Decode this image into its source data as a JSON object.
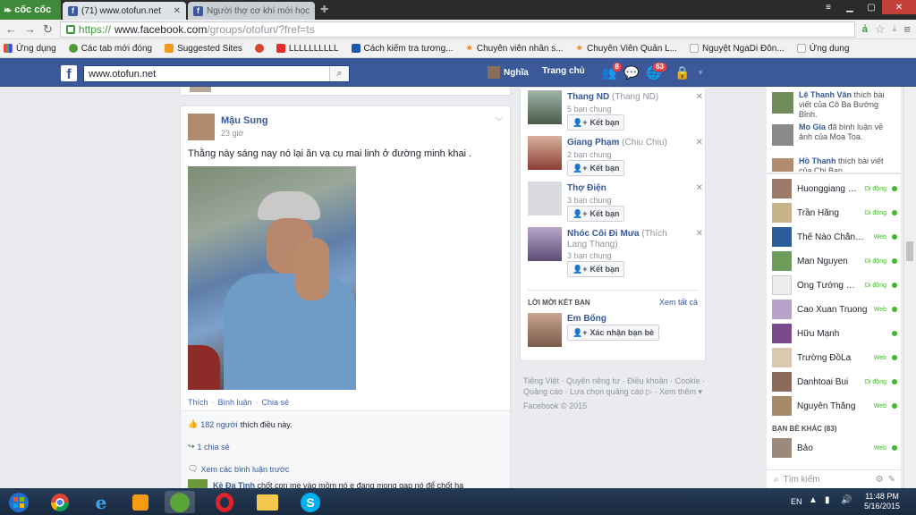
{
  "browser": {
    "brand": "cốc cốc",
    "tabs": [
      {
        "title": "(71) www.otofun.net",
        "active": true
      },
      {
        "title": "Người thợ cơ khí mới học",
        "active": false
      }
    ],
    "url_scheme": "https://",
    "url_host": "www.facebook.com",
    "url_path": "/groups/otofun/?fref=ts",
    "bookmarks": [
      "Ứng dụng",
      "Các tab mới đóng",
      "Suggested Sites",
      "LLLLLLLLLL",
      "Cách kiếm tra tương...",
      "Chuyên viên nhân s...",
      "Chuyên Viên Quản L...",
      "Nguyệt NgaDi Đôn...",
      "Ứng dung"
    ]
  },
  "fb": {
    "search_value": "www.otofun.net",
    "user_name": "Nghĩa",
    "home_label": "Trang chủ",
    "friend_badge": "8",
    "notif_badge": "63"
  },
  "post": {
    "author": "Mậu Sung",
    "time": "23 giờ",
    "text": "Thằng này sáng nay nó lại ăn vạ cụ mai linh ở đường minh khai .",
    "actions": [
      "Thích",
      "Bình luận",
      "Chia sẻ"
    ],
    "likes_count": "182 người",
    "likes_suffix": "thích điều này.",
    "shares": "1 chia sẻ",
    "view_comments": "Xem các bình luận trước",
    "comment_author": "Kẻ Đa Tình",
    "comment_text": "chốt con mẹ vào mồm nó e đang mong gap nó để chốt hạ"
  },
  "suggestions": [
    {
      "name": "Thang ND",
      "alias": "(Thang ND)",
      "mutual": "5 bạn chung",
      "button": "Kết bạn"
    },
    {
      "name": "Giang Phạm",
      "alias": "(Chiu Chiu)",
      "mutual": "2 bạn chung",
      "button": "Kết bạn"
    },
    {
      "name": "Thợ Điện",
      "alias": "",
      "mutual": "3 bạn chung",
      "button": "Kết bạn"
    },
    {
      "name": "Nhóc Côi Đi Mưa",
      "alias": "(Thích Lang Thang)",
      "mutual": "3 bạn chung",
      "button": "Kết bạn"
    }
  ],
  "friend_requests": {
    "title": "LỜI MỜI KẾT BẠN",
    "see_all": "Xem tất cả",
    "name": "Em Bống",
    "button": "Xác nhận bạn bè"
  },
  "footer": {
    "links": "Tiếng Việt · Quyền riêng tư · Điều khoản · Cookie · Quảng cáo · Lựa chọn quảng cáo ▷ · Xem thêm ▾",
    "copyright": "Facebook © 2015"
  },
  "ticker": [
    {
      "name": "Lê Thanh Vân",
      "text": "thích bài viết của Cô Ba Bướng Bỉnh."
    },
    {
      "name": "Mo Gia",
      "text": "đã bình luận về ảnh của Moa Toa."
    },
    {
      "name": "Hồ Thanh",
      "text": "thích bài viết của Chị Ban."
    }
  ],
  "chat": {
    "online": [
      {
        "name": "Huonggiang N...",
        "status": "Di động"
      },
      {
        "name": "Trần Hằng",
        "status": "Di động"
      },
      {
        "name": "Thế Nào Chẳng Đ...",
        "status": "Web"
      },
      {
        "name": "Man Nguyen",
        "status": "Di động"
      },
      {
        "name": "Ông Tướng Họ ...",
        "status": "Di động"
      },
      {
        "name": "Cao Xuan Truong",
        "status": "Web"
      },
      {
        "name": "Hữu Mạnh",
        "status": ""
      },
      {
        "name": "Trường ĐồLa",
        "status": "Web"
      },
      {
        "name": "Danhtoai Bui",
        "status": "Di động"
      },
      {
        "name": "Nguyễn Thắng",
        "status": "Web"
      }
    ],
    "others_title": "BẠN BÈ KHÁC (83)",
    "others": [
      {
        "name": "Bảo",
        "status": "Web"
      }
    ],
    "search_placeholder": "Tìm kiếm"
  },
  "taskbar": {
    "lang": "EN",
    "time": "11:48 PM",
    "date": "5/16/2015"
  }
}
